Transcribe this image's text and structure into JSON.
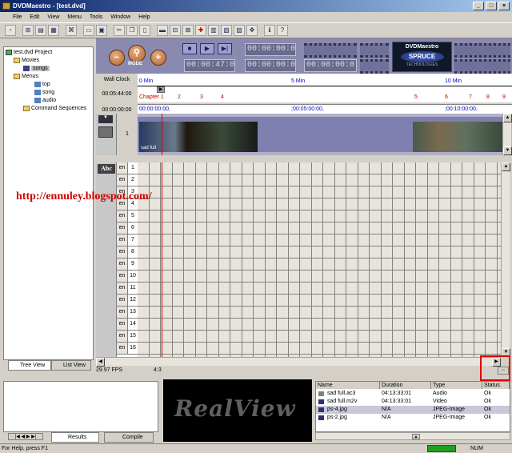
{
  "window": {
    "title": "DVDMaestro - [test.dvd]"
  },
  "menu": [
    "File",
    "Edit",
    "View",
    "Menu",
    "Tools",
    "Window",
    "Help"
  ],
  "tree": {
    "root": "test.dvd Project",
    "movies_label": "Movies",
    "movie_item": "songs",
    "menus_label": "Menus",
    "menu_items": [
      "top",
      "song",
      "audio"
    ],
    "cmd_label": "Command Sequences"
  },
  "tree_tabs": {
    "tree": "Tree View",
    "list": "List View"
  },
  "transport": {
    "tc1": "00:00:00:0",
    "tc2": "00:00:00:0",
    "tc3": "00:00:47:0",
    "tc4": "00:00:00:0",
    "mode": "MODE"
  },
  "logo": {
    "line1": "DVDMaestro",
    "line2": "SPRUCE",
    "line3": "TECHNOLOGIES"
  },
  "ruler": {
    "wall_clock": "Wall Clock",
    "duration": "00:05:44:00",
    "start": "00:00:00:00",
    "marks": [
      "0 Min",
      "5 Min",
      "10 Min"
    ],
    "tc_marks": [
      "00:00:00:00,",
      ";00:05:00:00,",
      ";00:10:00:00,"
    ],
    "chapters_left": [
      "Chapter 1",
      "2",
      "3",
      "4"
    ],
    "chapters_right": [
      "5",
      "6",
      "7",
      "8",
      "9"
    ]
  },
  "track": {
    "number": "1",
    "clip_label": "sad full"
  },
  "subtitles": {
    "abc": "Abc",
    "lang": "en",
    "rows": [
      1,
      2,
      3,
      4,
      5,
      6,
      7,
      8,
      9,
      10,
      11,
      12,
      13,
      14,
      15,
      16
    ]
  },
  "watermark": "http://ennuley.blogspot.com/",
  "info": {
    "fps": "29.97 FPS",
    "aspect": "4:3"
  },
  "results_tabs": {
    "results": "Results",
    "compile": "Compile"
  },
  "realview": "RealView",
  "files": {
    "headers": [
      "Name",
      "Duration",
      "Type",
      "Status"
    ],
    "rows": [
      {
        "name": "sad full.ac3",
        "duration": "04:13:33:01",
        "type": "Audio",
        "status": "Ok"
      },
      {
        "name": "sad full.m2v",
        "duration": "04:13:33:01",
        "type": "Video",
        "status": "Ok"
      },
      {
        "name": "ps-4.jpg",
        "duration": "N/A",
        "type": "JPEG-Image",
        "status": "Ok"
      },
      {
        "name": "ps-2.jpg",
        "duration": "N/A",
        "type": "JPEG-Image",
        "status": "Ok"
      }
    ]
  },
  "status": {
    "help": "For Help, press F1",
    "num": "NUM"
  }
}
